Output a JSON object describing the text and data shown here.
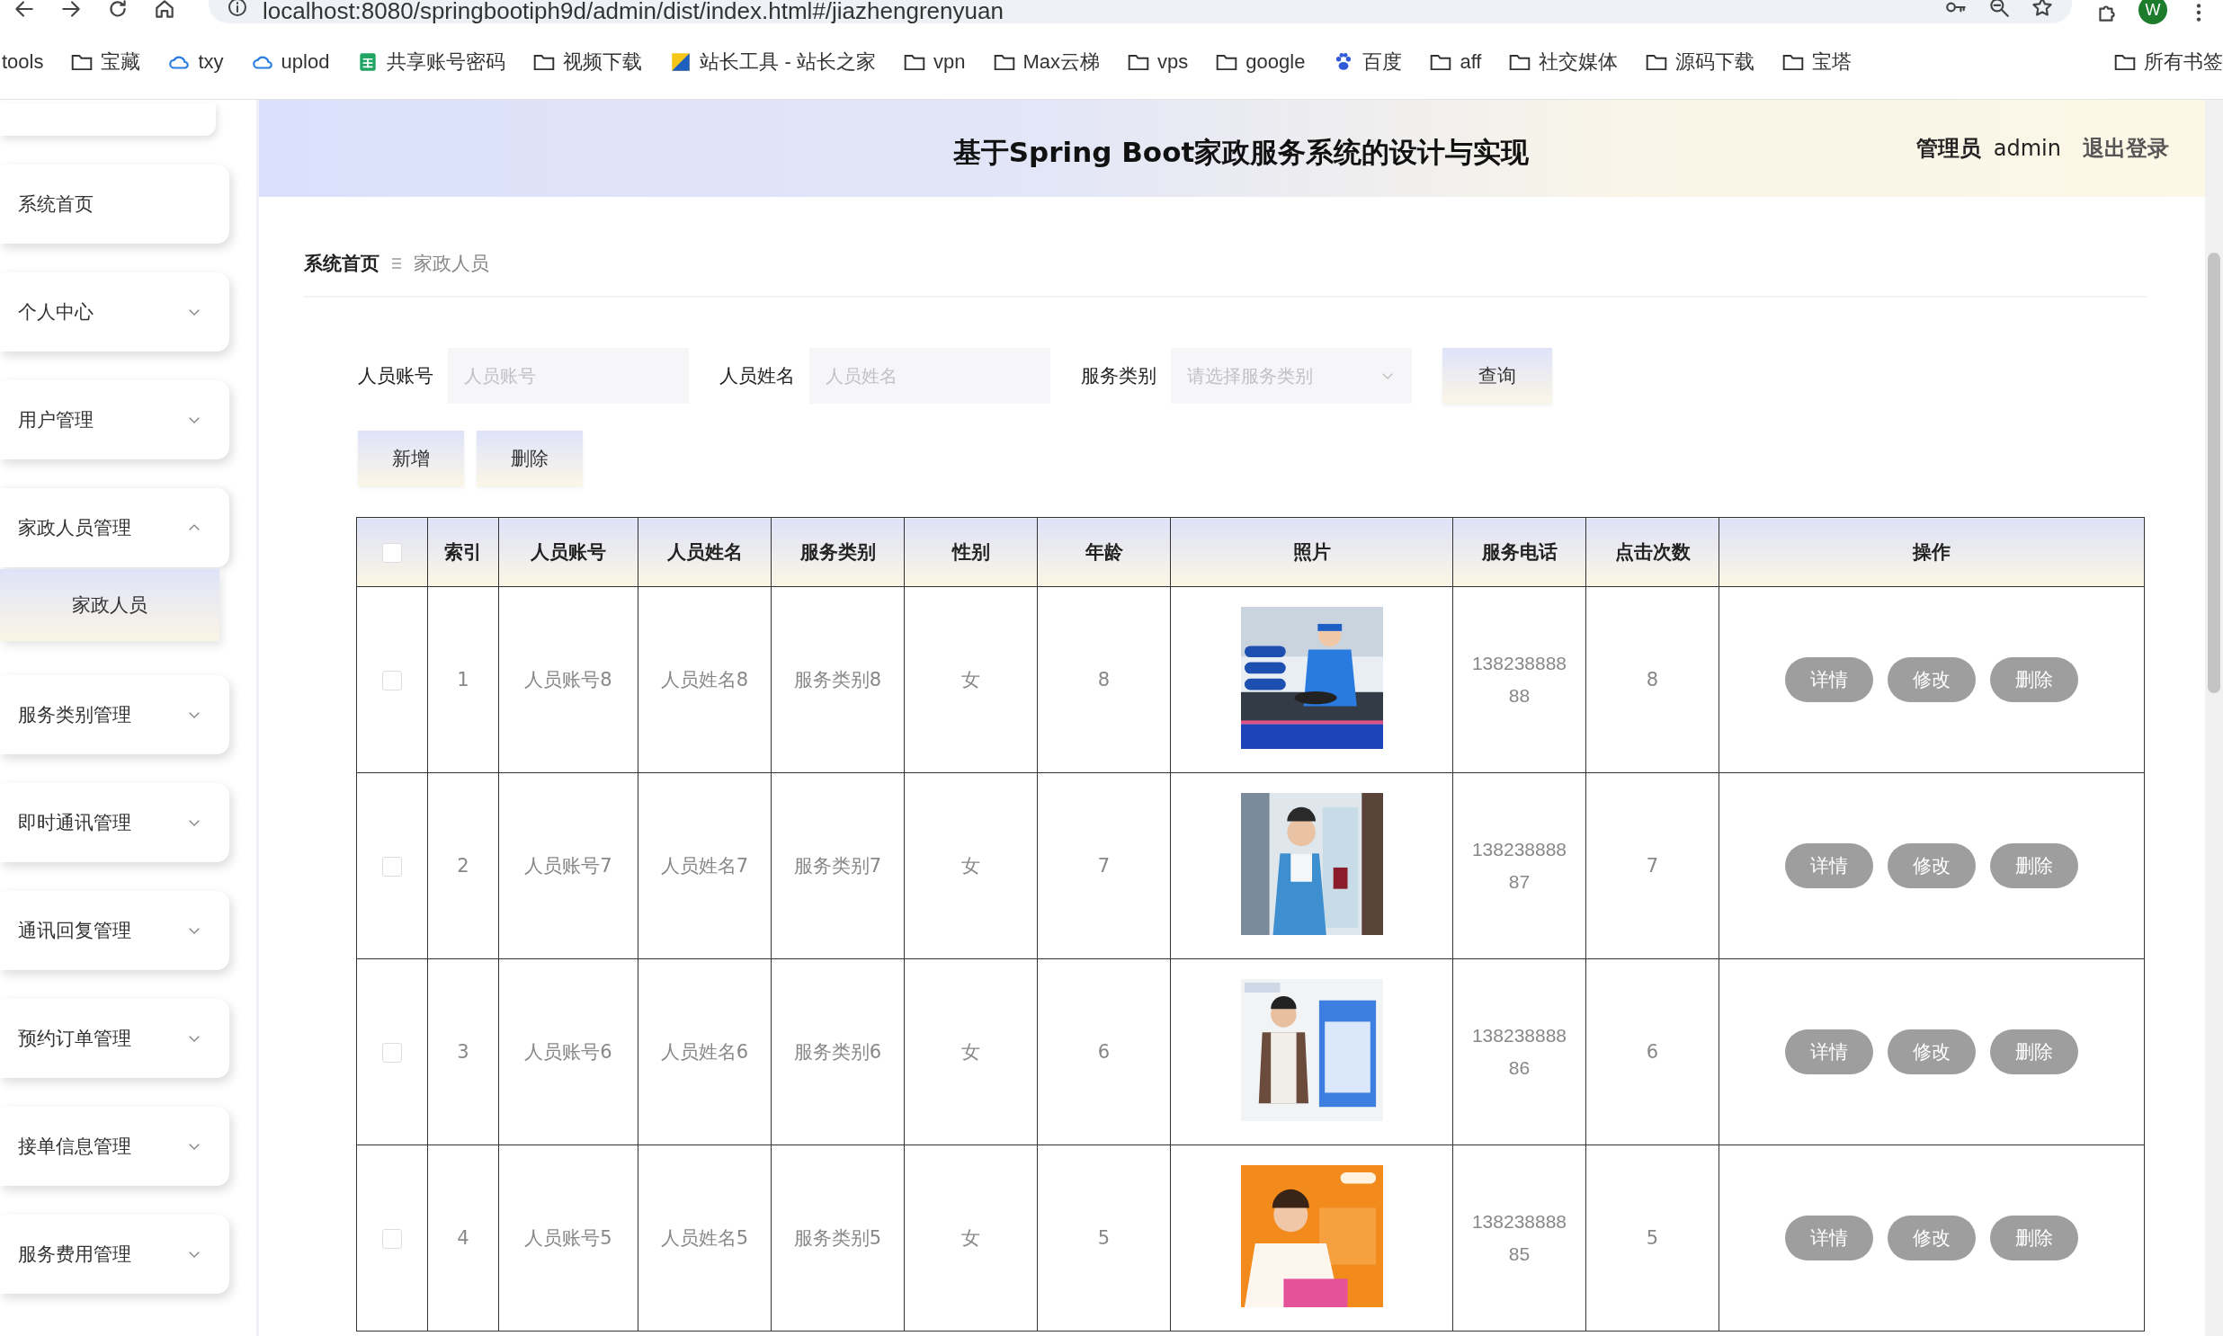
{
  "browser": {
    "url": "localhost:8080/springbootiph9d/admin/dist/index.html#/jiazhengrenyuan",
    "profile": "W",
    "bookmarks": [
      {
        "label": "tools",
        "kind": "plain"
      },
      {
        "label": "宝藏",
        "kind": "folder"
      },
      {
        "label": "txy",
        "kind": "cloud"
      },
      {
        "label": "uplod",
        "kind": "cloud"
      },
      {
        "label": "共享账号密码",
        "kind": "sheet"
      },
      {
        "label": "视频下载",
        "kind": "folder"
      },
      {
        "label": "站长工具 - 站长之家",
        "kind": "site"
      },
      {
        "label": "vpn",
        "kind": "folder"
      },
      {
        "label": "Max云梯",
        "kind": "folder"
      },
      {
        "label": "vps",
        "kind": "folder"
      },
      {
        "label": "google",
        "kind": "folder"
      },
      {
        "label": "百度",
        "kind": "paw"
      },
      {
        "label": "aff",
        "kind": "folder"
      },
      {
        "label": "社交媒体",
        "kind": "folder"
      },
      {
        "label": "源码下载",
        "kind": "folder"
      },
      {
        "label": "宝塔",
        "kind": "folder"
      },
      {
        "label": "所有书签",
        "kind": "folder"
      }
    ]
  },
  "sidebar": {
    "items": [
      {
        "label": "系统首页",
        "kind": "link"
      },
      {
        "label": "个人中心",
        "kind": "group",
        "expanded": false
      },
      {
        "label": "用户管理",
        "kind": "group",
        "expanded": false
      },
      {
        "label": "家政人员管理",
        "kind": "group",
        "expanded": true,
        "children": [
          {
            "label": "家政人员",
            "selected": true
          }
        ]
      },
      {
        "label": "服务类别管理",
        "kind": "group",
        "expanded": false
      },
      {
        "label": "即时通讯管理",
        "kind": "group",
        "expanded": false
      },
      {
        "label": "通讯回复管理",
        "kind": "group",
        "expanded": false
      },
      {
        "label": "预约订单管理",
        "kind": "group",
        "expanded": false
      },
      {
        "label": "接单信息管理",
        "kind": "group",
        "expanded": false
      },
      {
        "label": "服务费用管理",
        "kind": "group",
        "expanded": false
      }
    ]
  },
  "header": {
    "title": "基于Spring Boot家政服务系统的设计与实现",
    "role": "管理员",
    "user": "admin",
    "logout": "退出登录"
  },
  "breadcrumb": [
    "系统首页",
    "家政人员"
  ],
  "search": {
    "fields": [
      {
        "label": "人员账号",
        "placeholder": "人员账号",
        "kind": "text"
      },
      {
        "label": "人员姓名",
        "placeholder": "人员姓名",
        "kind": "text"
      },
      {
        "label": "服务类别",
        "placeholder": "请选择服务类别",
        "kind": "select"
      }
    ],
    "button": "查询"
  },
  "actions": [
    "新增",
    "删除"
  ],
  "table": {
    "select_all": false,
    "columns": [
      "索引",
      "人员账号",
      "人员姓名",
      "服务类别",
      "性别",
      "年龄",
      "照片",
      "服务电话",
      "点击次数",
      "操作"
    ],
    "rows": [
      {
        "checked": false,
        "index": "1",
        "account": "人员账号8",
        "name": "人员姓名8",
        "category": "服务类别8",
        "gender": "女",
        "age": "8",
        "photo": {
          "kind": "picture"
        },
        "phone": "13823888888",
        "clicks": "8",
        "buttons": [
          "详情",
          "修改",
          "删除"
        ]
      },
      {
        "checked": false,
        "index": "2",
        "account": "人员账号7",
        "name": "人员姓名7",
        "category": "服务类别7",
        "gender": "女",
        "age": "7",
        "photo": {
          "kind": "picture"
        },
        "phone": "13823888887",
        "clicks": "7",
        "buttons": [
          "详情",
          "修改",
          "删除"
        ]
      },
      {
        "checked": false,
        "index": "3",
        "account": "人员账号6",
        "name": "人员姓名6",
        "category": "服务类别6",
        "gender": "女",
        "age": "6",
        "photo": {
          "kind": "picture"
        },
        "phone": "13823888886",
        "clicks": "6",
        "buttons": [
          "详情",
          "修改",
          "删除"
        ]
      },
      {
        "checked": false,
        "index": "4",
        "account": "人员账号5",
        "name": "人员姓名5",
        "category": "服务类别5",
        "gender": "女",
        "age": "5",
        "photo": {
          "kind": "picture"
        },
        "phone": "13823888885",
        "clicks": "5",
        "buttons": [
          "详情",
          "修改",
          "删除"
        ]
      }
    ]
  }
}
